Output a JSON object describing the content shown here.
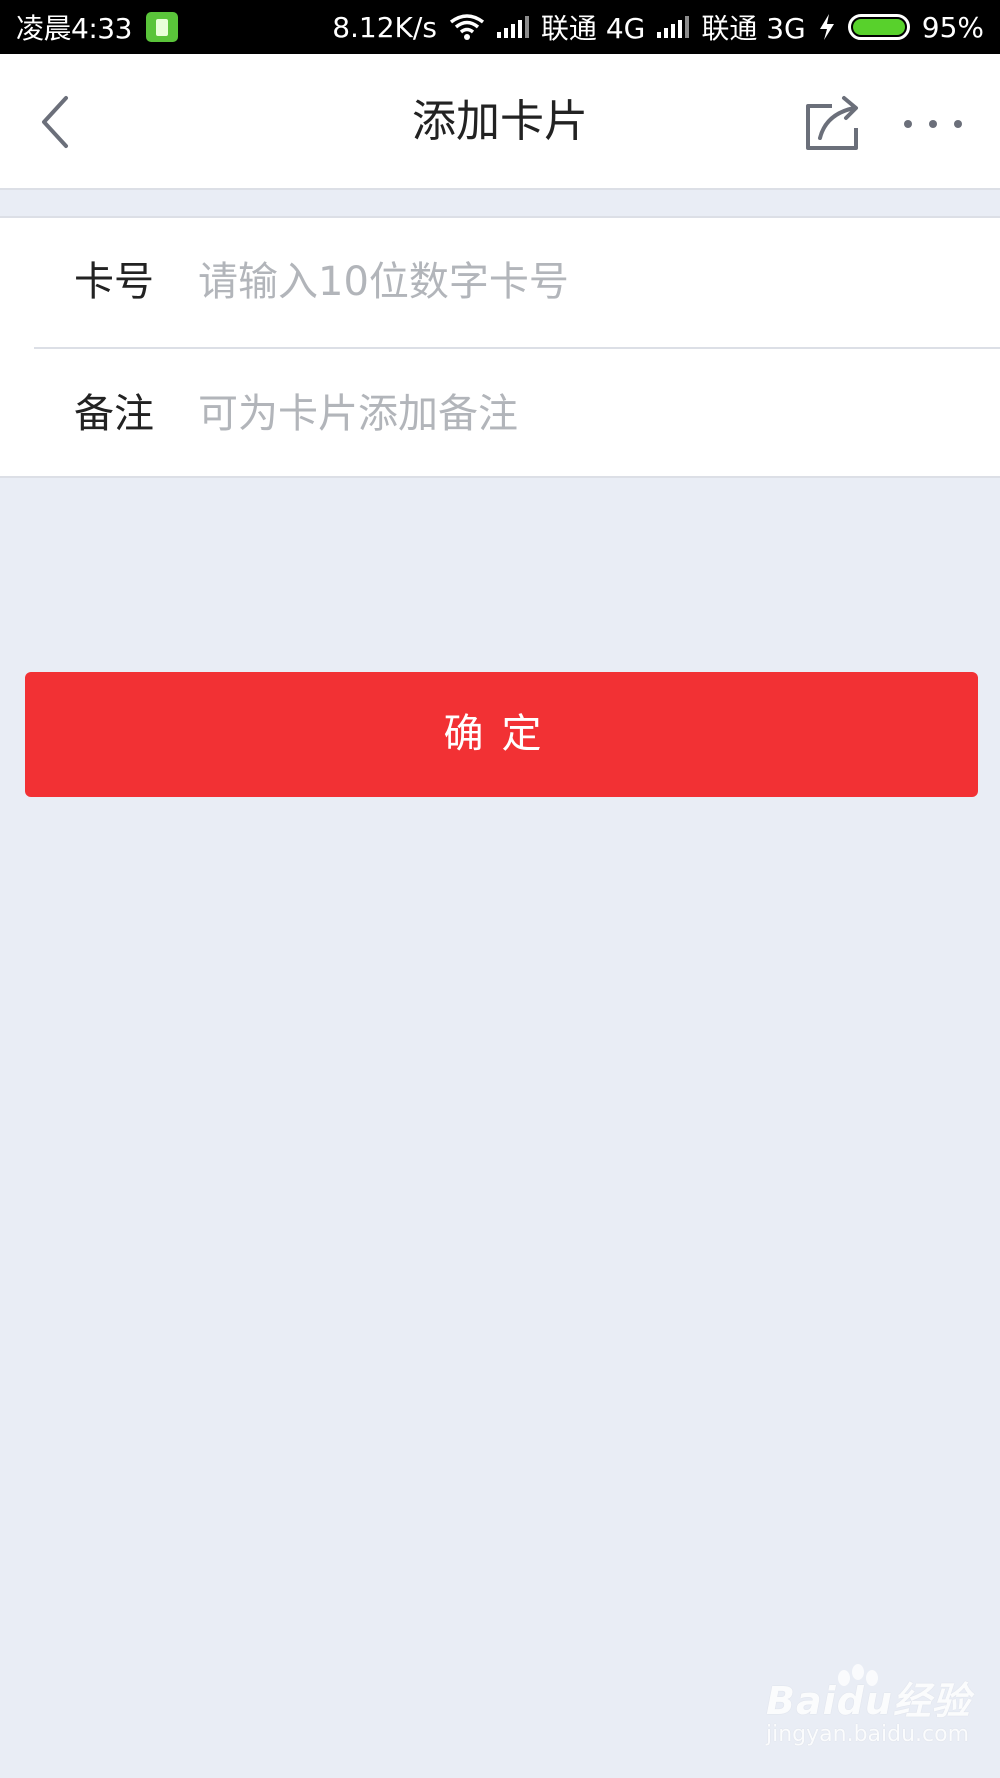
{
  "status_bar": {
    "time": "凌晨4:33",
    "net_speed": "8.12K/s",
    "carrier1": "联通 4G",
    "carrier2": "联通 3G",
    "battery": "95%"
  },
  "nav": {
    "title": "添加卡片",
    "icons": [
      "back-icon",
      "share-icon",
      "more-icon"
    ]
  },
  "form": {
    "card_label": "卡号",
    "card_placeholder": "请输入10位数字卡号",
    "card_value": "",
    "note_label": "备注",
    "note_placeholder": "可为卡片添加备注",
    "note_value": ""
  },
  "confirm_label": "确定",
  "watermark": {
    "main": "Baidu经验",
    "sub": "jingyan.baidu.com"
  },
  "colors": {
    "accent": "#f23134",
    "background": "#e9edf5",
    "status_bar": "#000000"
  }
}
